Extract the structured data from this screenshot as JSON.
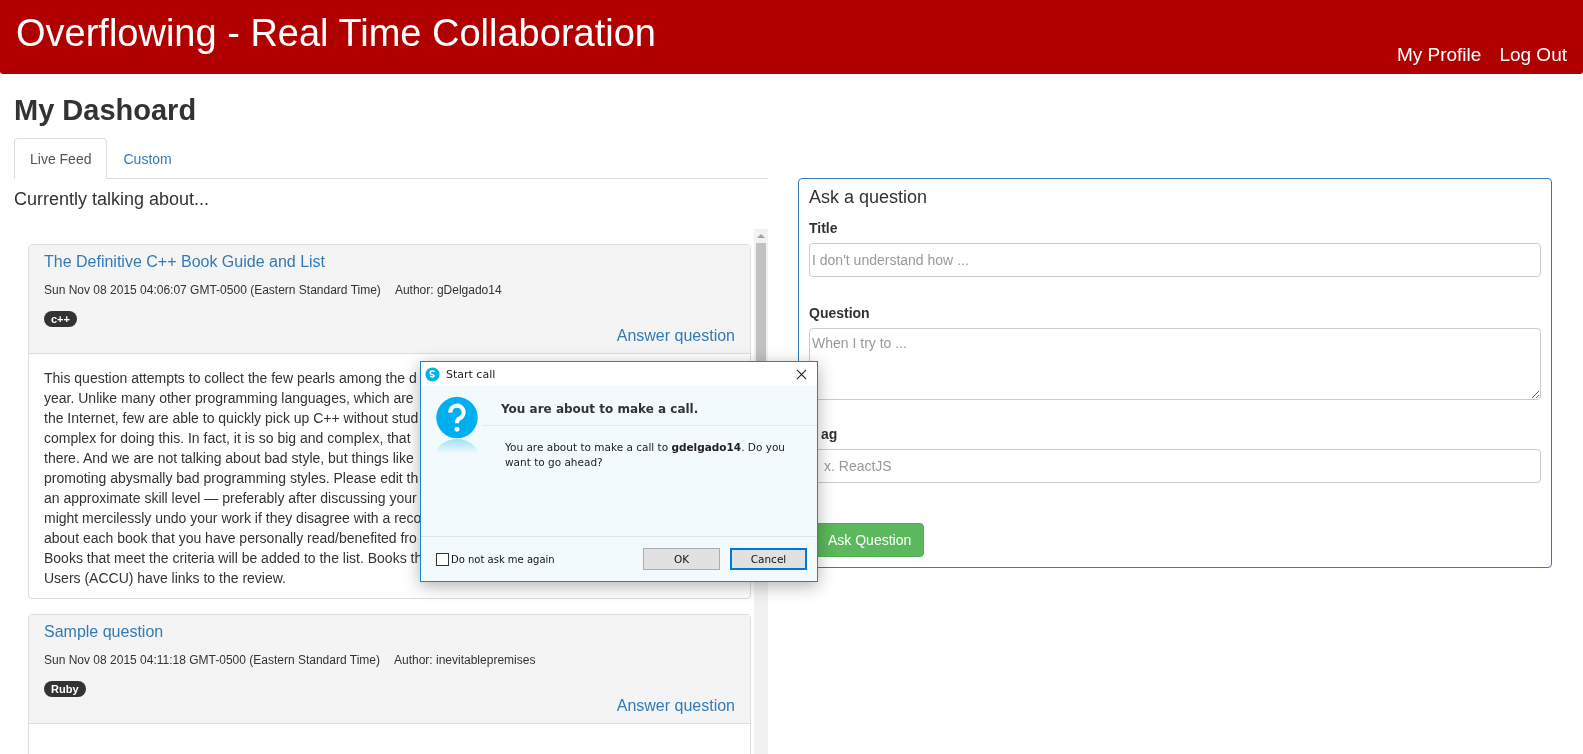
{
  "navbar": {
    "brand": "Overflowing - Real Time Collaboration",
    "links": [
      "My Profile",
      "Log Out"
    ]
  },
  "page_title": "My Dashoard",
  "tabs": [
    {
      "label": "Live Feed",
      "selected": true
    },
    {
      "label": "Custom",
      "selected": false
    }
  ],
  "feed": {
    "heading": "Currently talking about...",
    "questions": [
      {
        "title": "The Definitive C++ Book Guide and List",
        "date": "Sun Nov 08 2015 04:06:07 GMT-0500 (Eastern Standard Time)",
        "author": "Author: gDelgado14",
        "tag": "c++",
        "answer": "Answer question",
        "body_lines": [
          "This question attempts to collect the few pearls among the d",
          "year. Unlike many other programming languages, which are",
          "the Internet, few are able to quickly pick up C++ without stud",
          "complex for doing this. In fact, it is so big and complex, that",
          "there. And we are not talking about bad style, but things like",
          "promoting abysmally bad programming styles. Please edit th",
          "an approximate skill level — preferably after discussing your",
          "might mercilessly undo your work if they disagree with a reco",
          "about each book that you have personally read/benefited fro",
          "Books that meet the criteria will be added to the list. Books th",
          "Users (ACCU) have links to the review."
        ]
      },
      {
        "title": "Sample question",
        "date": "Sun Nov 08 2015 04:11:18 GMT-0500 (Eastern Standard Time)",
        "author": "Author: inevitablepremises",
        "tag": "Ruby",
        "answer": "Answer question"
      }
    ]
  },
  "ask_panel": {
    "heading": "Ask a question",
    "fields": [
      {
        "kind": "input",
        "label": "Title",
        "placeholder": "I don't understand how ..."
      },
      {
        "kind": "textarea",
        "label": "Question",
        "placeholder": "When I try to ..."
      },
      {
        "kind": "input",
        "label": "ag",
        "placeholder": "x. ReactJS"
      }
    ],
    "submit": "Ask Question"
  },
  "dialog": {
    "title": "Start call",
    "heading": "You are about to make a call.",
    "message": "You are about to make a call to **gdelgado14**. Do you want to go ahead?",
    "checkbox": {
      "label": "Do not ask me again",
      "checked": false
    },
    "buttons": [
      "OK",
      "Cancel"
    ]
  }
}
